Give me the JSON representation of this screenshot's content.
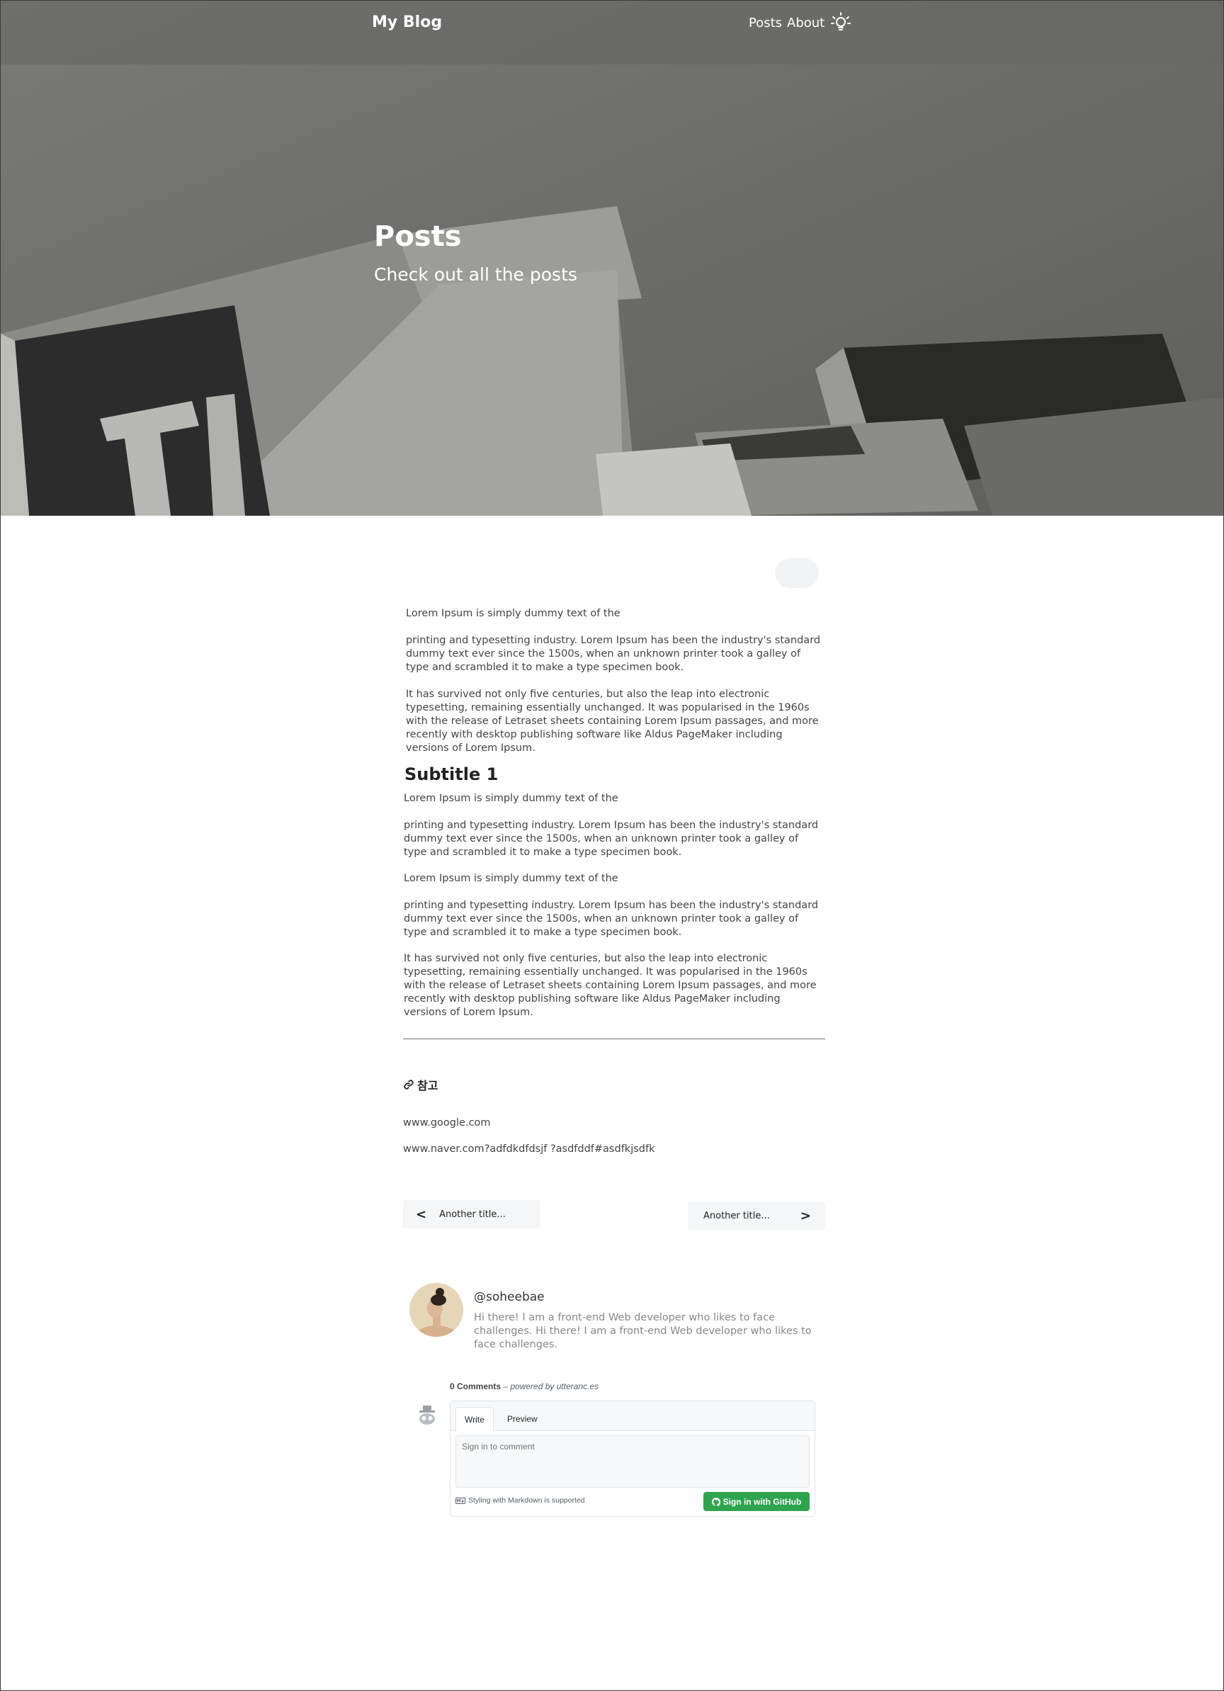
{
  "nav": {
    "brand": "My Blog",
    "links": [
      "Posts",
      "About"
    ],
    "theme_toggle_icon": "lightbulb-icon"
  },
  "hero": {
    "title": "Posts",
    "subtitle": "Check out all the posts"
  },
  "article": {
    "intro": [
      "Lorem Ipsum is simply dummy text of the",
      "printing and typesetting industry. Lorem Ipsum has been the industry's standard dummy text ever since the 1500s, when an unknown printer took a galley of type and scrambled it to make a type specimen book.",
      "It has survived not only five centuries, but also the leap into electronic typesetting, remaining essentially unchanged. It was popularised in the 1960s with the release of Letraset sheets containing Lorem Ipsum passages, and more recently with desktop publishing software like Aldus PageMaker including versions of Lorem Ipsum."
    ],
    "subtitle": "Subtitle 1",
    "body": [
      "Lorem Ipsum is simply dummy text of the",
      "printing and typesetting industry. Lorem Ipsum has been the industry's standard dummy text ever since the 1500s, when an unknown printer took a galley of type and scrambled it to make a type specimen book.",
      "Lorem Ipsum is simply dummy text of the",
      "printing and typesetting industry. Lorem Ipsum has been the industry's standard dummy text ever since the 1500s, when an unknown printer took a galley of type and scrambled it to make a type specimen book.",
      "It has survived not only five centuries, but also the leap into electronic typesetting, remaining essentially unchanged. It was popularised in the 1960s with the release of Letraset sheets containing Lorem Ipsum passages, and more recently with desktop publishing software like Aldus PageMaker including versions of Lorem Ipsum."
    ],
    "references_heading": "참고",
    "references": [
      "www.google.com",
      "www.naver.com?adfdkdfdsjf ?asdfddf#asdfkjsdfk"
    ]
  },
  "pager": {
    "prev_arrow": "<",
    "prev_label": "Another title...",
    "next_label": "Another title...",
    "next_arrow": ">"
  },
  "author": {
    "handle": "@soheebae",
    "bio": "Hi there! I am a front-end Web developer who likes to face challenges. Hi there! I am a front-end Web developer who likes to face challenges."
  },
  "comments": {
    "count_label": "0 Comments",
    "powered_by": " – powered by utteranc.es",
    "tab_write": "Write",
    "tab_preview": "Preview",
    "placeholder": "Sign in to comment",
    "markdown_note": "Styling with Markdown is supported",
    "signin_label": "Sign in with GitHub",
    "signin_color": "#2ea44f"
  }
}
